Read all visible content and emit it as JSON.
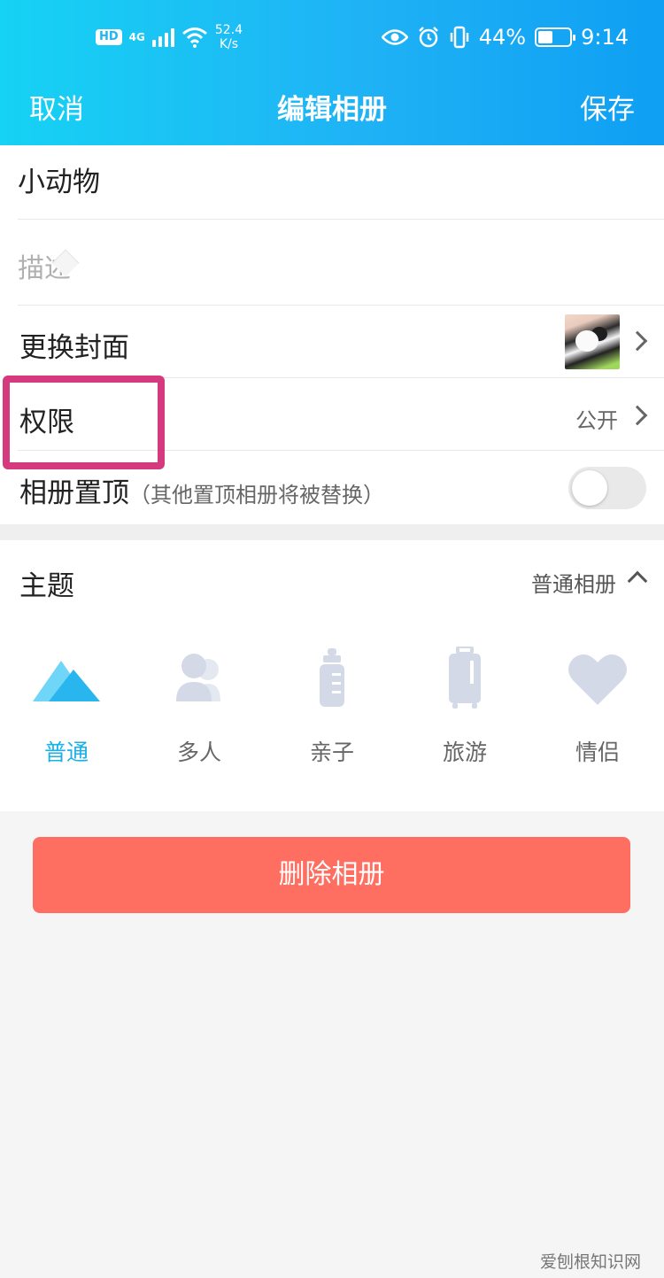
{
  "status_bar": {
    "hd": "HD",
    "network": "4G",
    "speed_value": "52.4",
    "speed_unit": "K/s",
    "battery": "44%",
    "time": "9:14"
  },
  "nav": {
    "cancel": "取消",
    "title": "编辑相册",
    "save": "保存"
  },
  "form": {
    "album_name": "小动物",
    "description_placeholder": "描述",
    "cover_label": "更换封面",
    "permission_label": "权限",
    "permission_value": "公开",
    "pin_label": "相册置顶",
    "pin_hint": "（其他置顶相册将被替换）",
    "pin_enabled": false
  },
  "theme": {
    "label": "主题",
    "current": "普通相册",
    "options": [
      {
        "name": "普通",
        "icon": "mountain-icon",
        "active": true
      },
      {
        "name": "多人",
        "icon": "people-icon",
        "active": false
      },
      {
        "name": "亲子",
        "icon": "baby-bottle-icon",
        "active": false
      },
      {
        "name": "旅游",
        "icon": "suitcase-icon",
        "active": false
      },
      {
        "name": "情侣",
        "icon": "heart-icon",
        "active": false
      }
    ]
  },
  "actions": {
    "delete": "删除相册"
  },
  "watermark": "爱刨根知识网",
  "colors": {
    "header_start": "#16d2f4",
    "header_end": "#0f9ff3",
    "accent": "#18b2e8",
    "delete_button": "#ff6f61",
    "highlight_box": "#d63a7e",
    "inactive_icon": "#d3d9e6"
  }
}
